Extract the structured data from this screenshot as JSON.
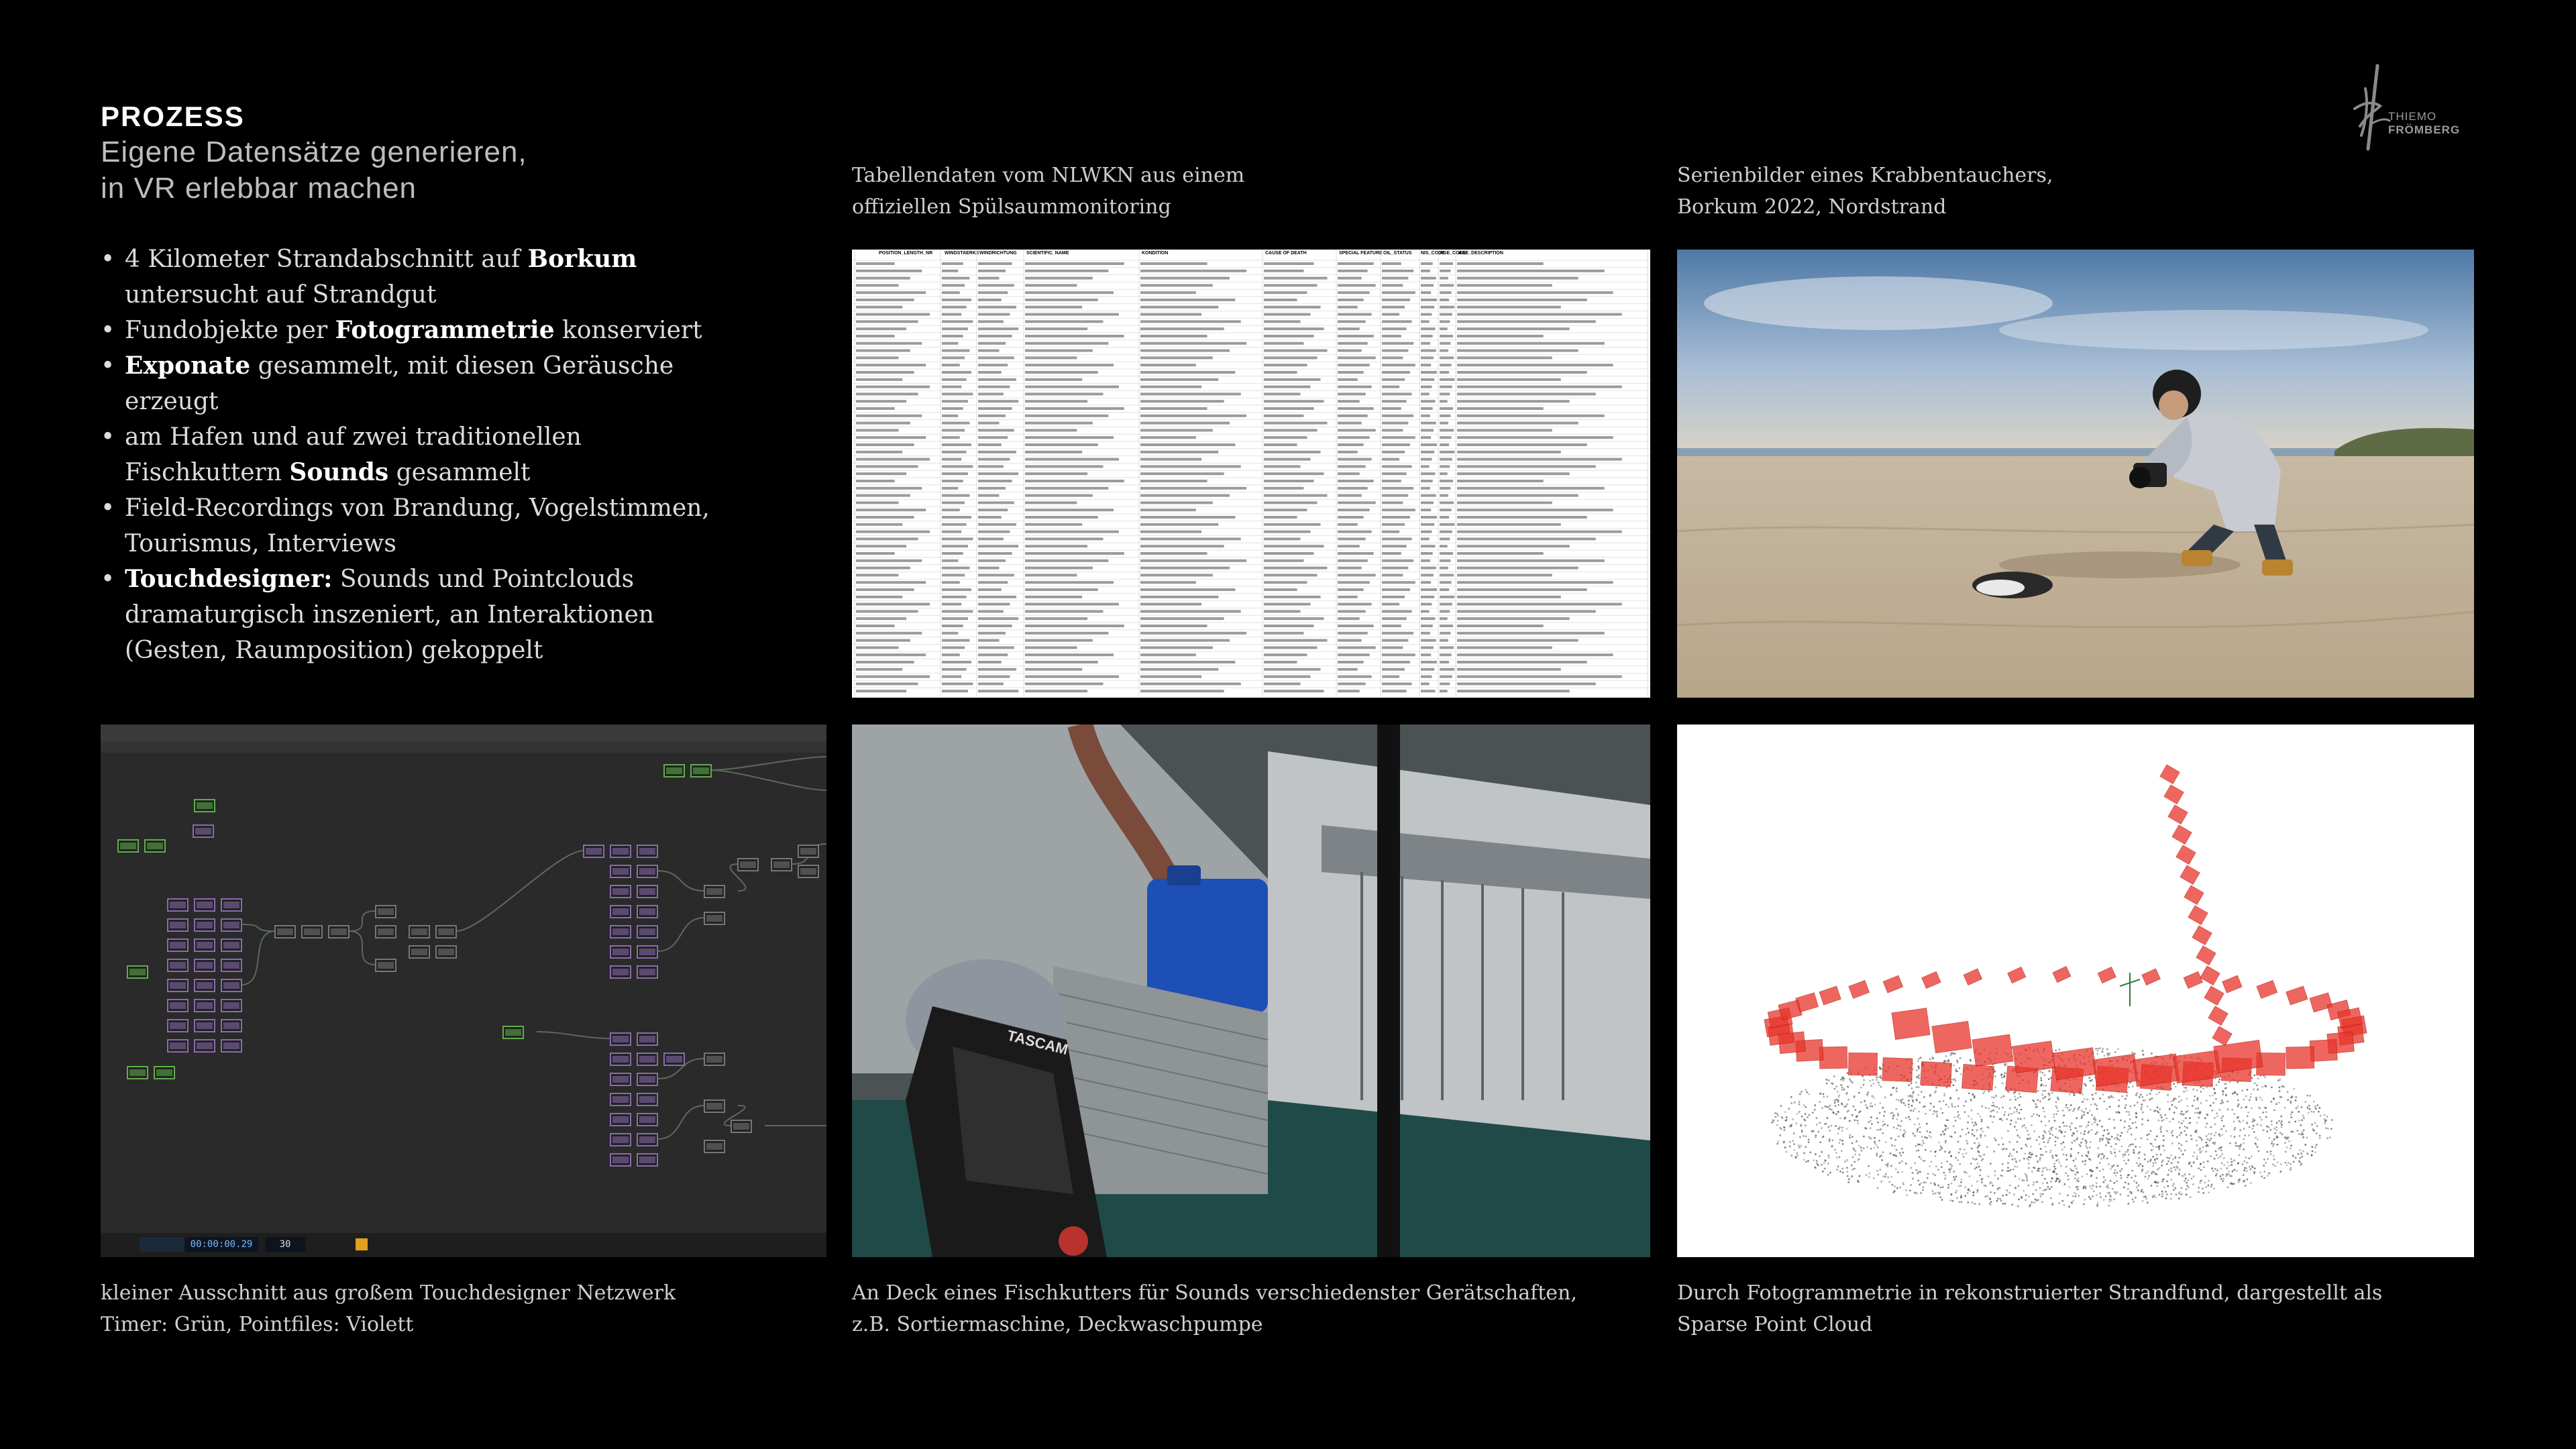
{
  "heading": {
    "title": "PROZESS",
    "subtitle_line1": "Eigene Datensätze generieren,",
    "subtitle_line2": "in VR erlebbar machen"
  },
  "bullets": [
    {
      "pre": "4 Kilometer Strandabschnitt auf ",
      "bold": "Borkum",
      "post": " untersucht auf Strandgut"
    },
    {
      "pre": "Fundobjekte per ",
      "bold": "Fotogrammetrie",
      "post": " konserviert"
    },
    {
      "pre": "",
      "bold": "Exponate",
      "post": " gesammelt, mit diesen Geräusche erzeugt"
    },
    {
      "pre": "am Hafen und auf zwei traditionellen Fischkuttern ",
      "bold": "Sounds",
      "post": " gesammelt"
    },
    {
      "pre": "Field-Recordings von Brandung, Vogelstimmen, Tourismus, Interviews",
      "bold": "",
      "post": ""
    },
    {
      "pre": "",
      "bold": "Touchdesigner:",
      "post": " Sounds und Pointclouds dramatur­gisch inszeniert, an Interaktionen (Gesten, Raumpo­sition) gekoppelt"
    }
  ],
  "logo": {
    "line1": "THIEMO",
    "line2": "FRÖMBERG",
    "icon": "signature-logo-icon"
  },
  "captions": {
    "sheet": [
      "Tabellendaten vom NLWKN aus einem",
      "offiziellen Spülsaummonitoring"
    ],
    "beach": [
      "Serienbilder eines Krabbentauchers,",
      "Borkum 2022, Nordstrand"
    ],
    "td": [
      "kleiner Ausschnitt aus großem Touchdesigner Netzwerk",
      "Timer: Grün, Pointfiles: Violett"
    ],
    "deck": [
      "An Deck eines Fischkutters für Sounds verschiedenster Gerätschaften,",
      "z.B. Sortiermaschine, Deckwaschpumpe"
    ],
    "cloud": [
      "Durch Fotogrammetrie in rekonstruierter Strandfund, dargestellt als",
      "Sparse Point Cloud"
    ]
  },
  "spreadsheet": {
    "headers": [
      "POSITION_LENGTH_NR",
      "WINDSTAERKE",
      "WINDRICHTUNG",
      "SCIENTIFIC_NAME",
      "KONDITION",
      "CAUSE OF DEATH",
      "SPECIAL FEATURE",
      "OIL_STATUS",
      "NIS_CODE",
      "AGE_CODE",
      "AGE_DESCRIPTION"
    ]
  },
  "touchdesigner": {
    "time_display": "00:00:00.29",
    "frame_value": "30"
  },
  "recorder": {
    "brand": "TASCAM"
  },
  "colors": {
    "timer": "#5fae4a",
    "pointfiles": "#8a6bb0",
    "cloud_frames": "#e8352b"
  }
}
